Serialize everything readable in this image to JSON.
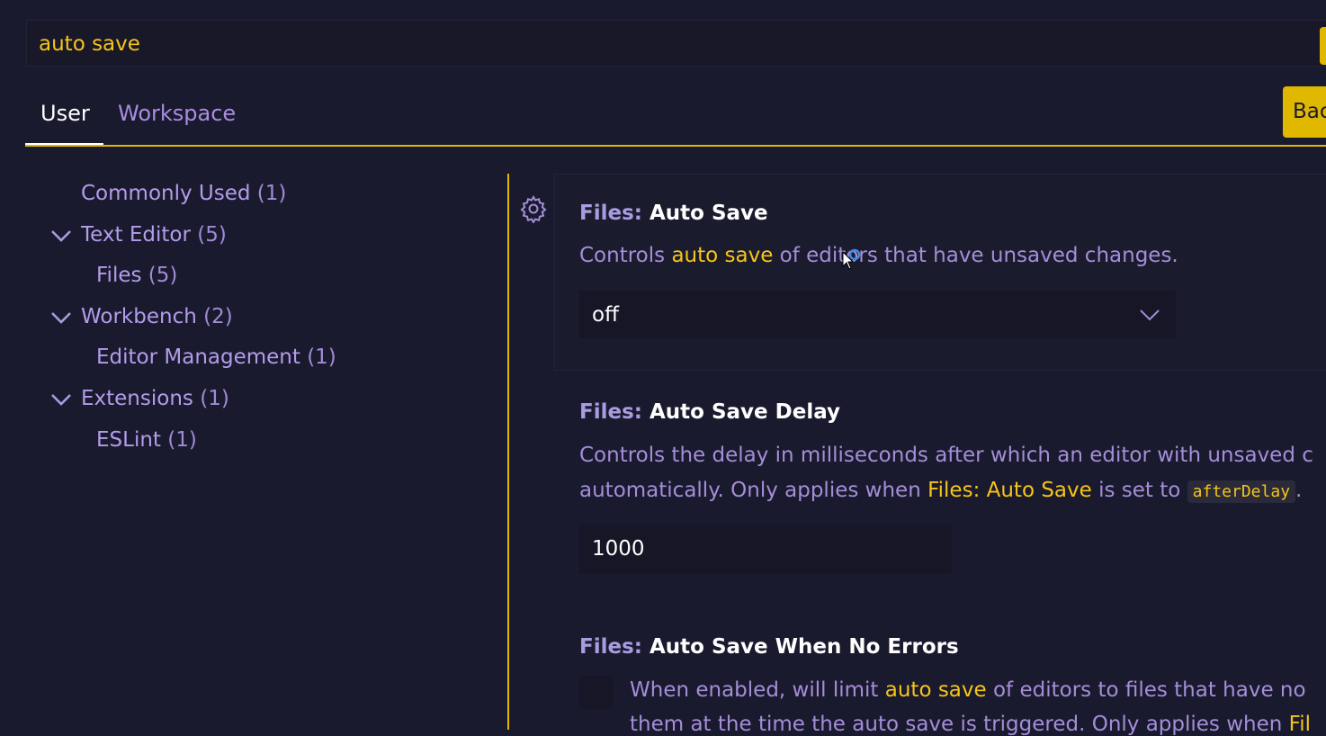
{
  "search": {
    "value": "auto save"
  },
  "tabs": [
    {
      "label": "User",
      "active": true
    },
    {
      "label": "Workspace",
      "active": false
    }
  ],
  "backup_button": {
    "label": "Bac"
  },
  "toc": [
    {
      "label": "Commonly Used",
      "count": "(1)",
      "expandable": false
    },
    {
      "label": "Text Editor",
      "count": "(5)",
      "expandable": true
    },
    {
      "label": "Files",
      "count": "(5)",
      "expandable": false
    },
    {
      "label": "Workbench",
      "count": "(2)",
      "expandable": true
    },
    {
      "label": "Editor Management",
      "count": "(1)",
      "expandable": false
    },
    {
      "label": "Extensions",
      "count": "(1)",
      "expandable": true
    },
    {
      "label": "ESLint",
      "count": "(1)",
      "expandable": false
    }
  ],
  "settings": [
    {
      "category": "Files: ",
      "name": "Auto Save",
      "desc_before": "Controls ",
      "desc_highlight": "auto save",
      "desc_after": " of editors that have unsaved changes.",
      "value": "off"
    },
    {
      "category": "Files: ",
      "name": "Auto Save Delay",
      "desc_line1": "Controls the delay in milliseconds after which an editor with unsaved c",
      "desc_line2_before": "automatically. Only applies when ",
      "desc_line2_highlight": "Files: Auto Save",
      "desc_line2_mid": " is set to ",
      "desc_line2_code": "afterDelay",
      "desc_line2_after": ".",
      "value": "1000"
    },
    {
      "category": "Files: ",
      "name": "Auto Save When No Errors",
      "desc_line1_before": "When enabled, will limit ",
      "desc_line1_highlight": "auto save",
      "desc_line1_after": " of editors to files that have no",
      "desc_line2_before": "them at the time the auto save is triggered. Only applies when ",
      "desc_line2_highlight": "Fil",
      "checked": false
    }
  ],
  "colors": {
    "accent": "#e0b800",
    "highlight": "#f5c518",
    "background": "#1a1a2e",
    "text": "#a48ed8"
  },
  "icons": [
    "gear-icon",
    "chevron-down-icon",
    "mouse-cursor-icon"
  ]
}
